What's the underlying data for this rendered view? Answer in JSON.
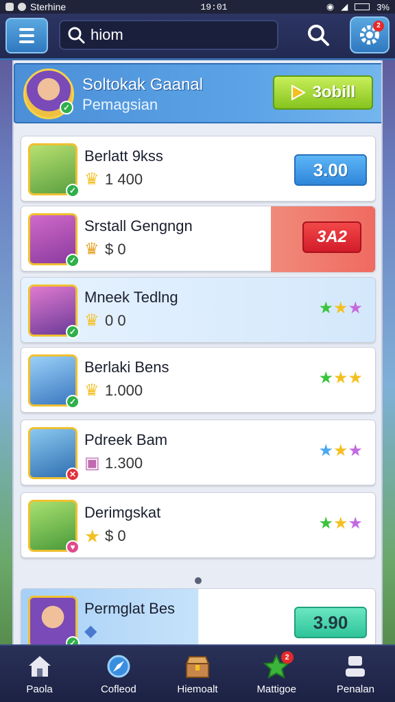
{
  "status_bar": {
    "carrier": "Sterhine",
    "time": "19:01",
    "battery": "3%"
  },
  "header": {
    "search_value": "hiom",
    "notifications": "2"
  },
  "profile": {
    "title": "Soltokak Gaanal",
    "subtitle": "Pemagsian",
    "button_label": "3obill"
  },
  "cards": [
    {
      "name": "Berlatt 9kss",
      "coins": "1 400",
      "action": "3.00",
      "action_style": "blue"
    },
    {
      "name": "Srstall Gengngn",
      "coins": "$ 0",
      "action": "3A2",
      "action_style": "red"
    },
    {
      "name": "Mneek Tedlng",
      "coins": "0 0",
      "stars": [
        "green",
        "yellow",
        "purple"
      ]
    },
    {
      "name": "Berlaki Bens",
      "coins": "1.000",
      "stars": [
        "green",
        "yellow",
        "yellow"
      ]
    },
    {
      "name": "Pdreek Bam",
      "coins": "1.300",
      "stars": [
        "blue",
        "yellow",
        "purple"
      ]
    },
    {
      "name": "Derimgskat",
      "coins": "$ 0",
      "stars": [
        "green",
        "yellow",
        "purple"
      ]
    }
  ],
  "bottom_card": {
    "name": "Permglat Bes",
    "action": "3.90"
  },
  "nav": [
    {
      "label": "Paola",
      "icon": "home-icon"
    },
    {
      "label": "Cofleod",
      "icon": "compass-icon"
    },
    {
      "label": "Hiemoalt",
      "icon": "chest-icon"
    },
    {
      "label": "Mattigoe",
      "icon": "star-icon",
      "badge": "2"
    },
    {
      "label": "Penalan",
      "icon": "profile-icon"
    }
  ],
  "colors": {
    "accent": "#2f86da",
    "header": "#222a52",
    "action_green": "#86c41e",
    "alert_red": "#d21c2a"
  }
}
